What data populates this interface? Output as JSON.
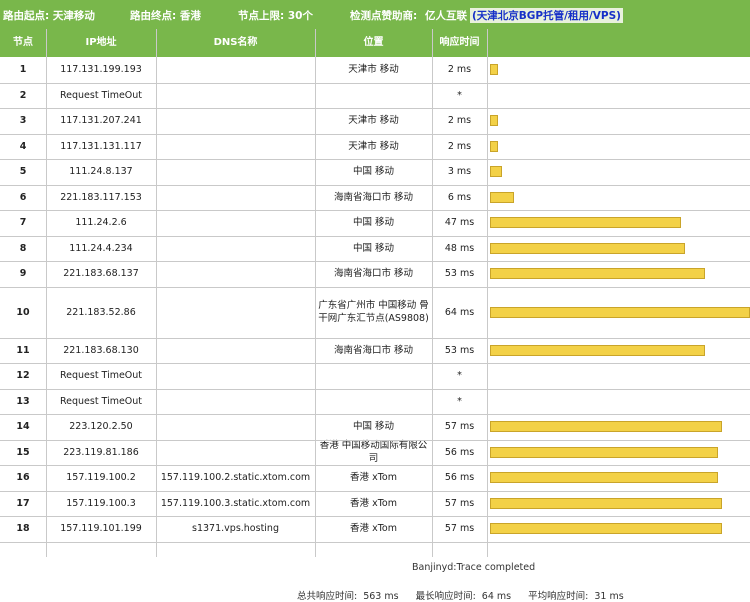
{
  "header": {
    "origin": "路由起点: 天津移动",
    "destination": "路由终点: 香港",
    "hop_limit": "节点上限: 30个",
    "sponsor_label": "检测点赞助商:",
    "sponsor_name": "亿人互联",
    "sponsor_detail": "(天津北京BGP托管/租用/VPS)"
  },
  "columns": [
    "节点",
    "IP地址",
    "DNS名称",
    "位置",
    "响应时间"
  ],
  "rows": [
    {
      "hop": "1",
      "ip": "117.131.199.193",
      "dns": "",
      "location": "天津市 移动",
      "time": "2 ms",
      "ms": 2
    },
    {
      "hop": "2",
      "ip": "Request TimeOut",
      "dns": "",
      "location": "",
      "time": "*",
      "ms": null
    },
    {
      "hop": "3",
      "ip": "117.131.207.241",
      "dns": "",
      "location": "天津市 移动",
      "time": "2 ms",
      "ms": 2
    },
    {
      "hop": "4",
      "ip": "117.131.131.117",
      "dns": "",
      "location": "天津市 移动",
      "time": "2 ms",
      "ms": 2
    },
    {
      "hop": "5",
      "ip": "111.24.8.137",
      "dns": "",
      "location": "中国 移动",
      "time": "3 ms",
      "ms": 3
    },
    {
      "hop": "6",
      "ip": "221.183.117.153",
      "dns": "",
      "location": "海南省海口市 移动",
      "time": "6 ms",
      "ms": 6
    },
    {
      "hop": "7",
      "ip": "111.24.2.6",
      "dns": "",
      "location": "中国 移动",
      "time": "47 ms",
      "ms": 47
    },
    {
      "hop": "8",
      "ip": "111.24.4.234",
      "dns": "",
      "location": "中国 移动",
      "time": "48 ms",
      "ms": 48
    },
    {
      "hop": "9",
      "ip": "221.183.68.137",
      "dns": "",
      "location": "海南省海口市 移动",
      "time": "53 ms",
      "ms": 53
    },
    {
      "hop": "10",
      "ip": "221.183.52.86",
      "dns": "",
      "location": "广东省广州市 中国移动 骨干网广东汇节点(AS9808)",
      "time": "64 ms",
      "ms": 64
    },
    {
      "hop": "11",
      "ip": "221.183.68.130",
      "dns": "",
      "location": "海南省海口市 移动",
      "time": "53 ms",
      "ms": 53
    },
    {
      "hop": "12",
      "ip": "Request TimeOut",
      "dns": "",
      "location": "",
      "time": "*",
      "ms": null
    },
    {
      "hop": "13",
      "ip": "Request TimeOut",
      "dns": "",
      "location": "",
      "time": "*",
      "ms": null
    },
    {
      "hop": "14",
      "ip": "223.120.2.50",
      "dns": "",
      "location": "中国 移动",
      "time": "57 ms",
      "ms": 57
    },
    {
      "hop": "15",
      "ip": "223.119.81.186",
      "dns": "",
      "location": "香港 中国移动国际有限公司",
      "time": "56 ms",
      "ms": 56
    },
    {
      "hop": "16",
      "ip": "157.119.100.2",
      "dns": "157.119.100.2.static.xtom.com",
      "location": "香港 xTom",
      "time": "56 ms",
      "ms": 56
    },
    {
      "hop": "17",
      "ip": "157.119.100.3",
      "dns": "157.119.100.3.static.xtom.com",
      "location": "香港 xTom",
      "time": "57 ms",
      "ms": 57
    },
    {
      "hop": "18",
      "ip": "157.119.101.199",
      "dns": "s1371.vps.hosting",
      "location": "香港 xTom",
      "time": "57 ms",
      "ms": 57
    }
  ],
  "footer": {
    "completed": "Banjinyd:Trace completed",
    "total_label": "总共响应时间:",
    "total_value": "563 ms",
    "max_label": "最长响应时间:",
    "max_value": "64 ms",
    "avg_label": "平均响应时间:",
    "avg_value": "31 ms"
  },
  "colors": {
    "header_bg": "#79b74b",
    "bar_fill": "#f3d147",
    "sponsor_link": "#1630c8"
  }
}
